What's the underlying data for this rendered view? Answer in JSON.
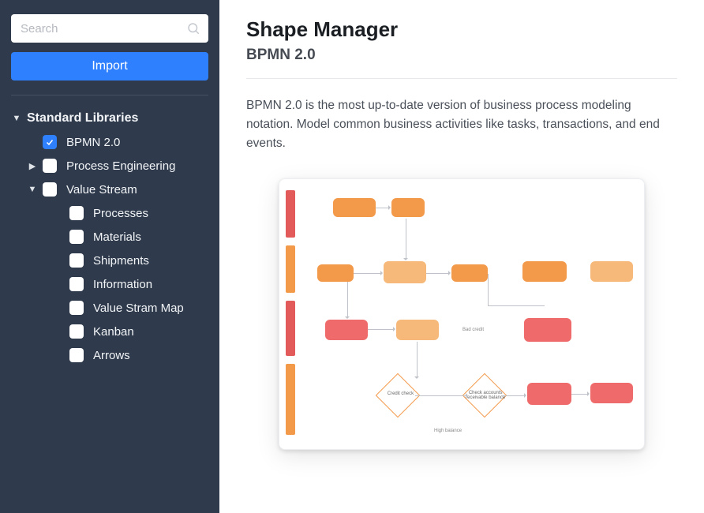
{
  "sidebar": {
    "search_placeholder": "Search",
    "import_label": "Import",
    "section_header": "Standard Libraries",
    "items": [
      {
        "label": "BPMN 2.0",
        "checked": true,
        "caret": "blank"
      },
      {
        "label": "Process Engineering",
        "checked": false,
        "caret": "right"
      },
      {
        "label": "Value Stream",
        "checked": false,
        "caret": "down"
      }
    ],
    "value_stream_children": [
      {
        "label": "Processes"
      },
      {
        "label": "Materials"
      },
      {
        "label": "Shipments"
      },
      {
        "label": "Information"
      },
      {
        "label": "Value Stram Map"
      },
      {
        "label": "Kanban"
      },
      {
        "label": "Arrows"
      }
    ]
  },
  "main": {
    "title": "Shape Manager",
    "subtitle": "BPMN 2.0",
    "description": "BPMN 2.0 is the most up-to-date version of business process modeling notation. Model common business activities like tasks, transactions, and end events."
  },
  "preview": {
    "lane_colors": [
      "red",
      "orange",
      "red",
      "orange"
    ],
    "bottom_label": "High balance",
    "diamonds": [
      {
        "label": "Credit check"
      },
      {
        "label": "Check accounts receivable balance"
      }
    ]
  }
}
